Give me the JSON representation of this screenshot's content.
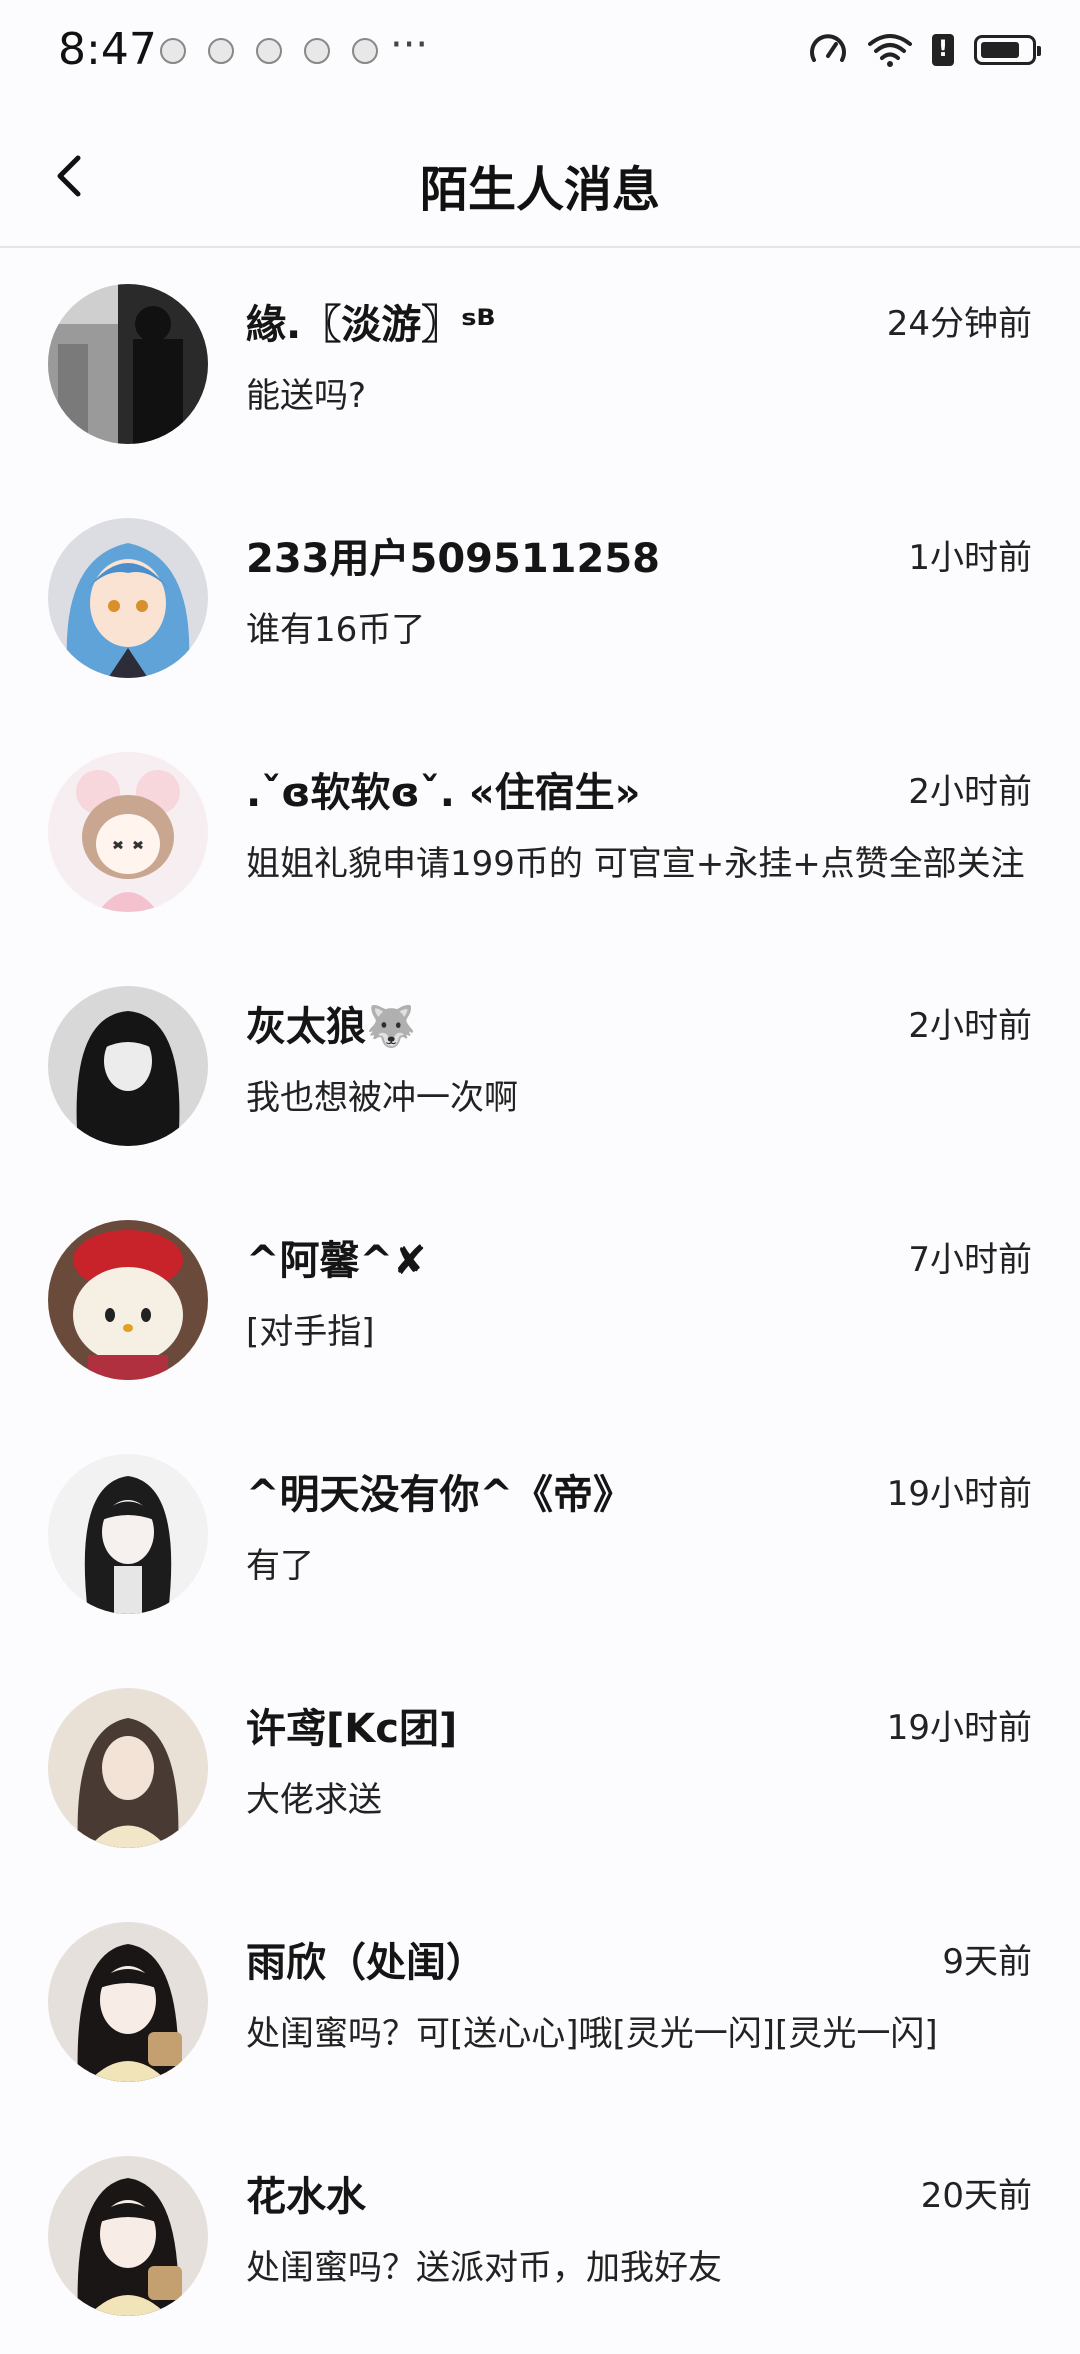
{
  "status_bar": {
    "time": "8:47",
    "more": "···",
    "notification_icons": [
      "app-icon",
      "app-icon",
      "app-icon",
      "app-icon",
      "app-icon"
    ],
    "right_icons": [
      "speed-icon",
      "wifi-icon",
      "alert-icon",
      "battery-icon"
    ]
  },
  "header": {
    "title": "陌生人消息",
    "back_icon": "chevron-left-icon"
  },
  "conversations": [
    {
      "name": "緣.〖淡游〗ˢᴮ",
      "time": "24分钟前",
      "message": "能送吗?"
    },
    {
      "name": "233用户509511258",
      "time": "1小时前",
      "message": "谁有16币了"
    },
    {
      "name": ".ˇɞ软软ɞˇ. «住宿生»",
      "time": "2小时前",
      "message": "姐姐礼貌申请199币的 可官宣+永挂+点赞全部关注"
    },
    {
      "name": "灰太狼🐺",
      "time": "2小时前",
      "message": "我也想被冲一次啊"
    },
    {
      "name": "^阿馨^✘",
      "time": "7小时前",
      "message": "[对手指]"
    },
    {
      "name": "^明天没有你^《帝》",
      "time": "19小时前",
      "message": "有了"
    },
    {
      "name": "许鸢[Kc团]",
      "time": "19小时前",
      "message": "大佬求送"
    },
    {
      "name": "雨欣（处闺）",
      "time": "9天前",
      "message": "处闺蜜吗？可[送心心]哦[灵光一闪][灵光一闪]"
    },
    {
      "name": "花水水",
      "time": "20天前",
      "message": "处闺蜜吗？送派对币，加我好友"
    }
  ]
}
